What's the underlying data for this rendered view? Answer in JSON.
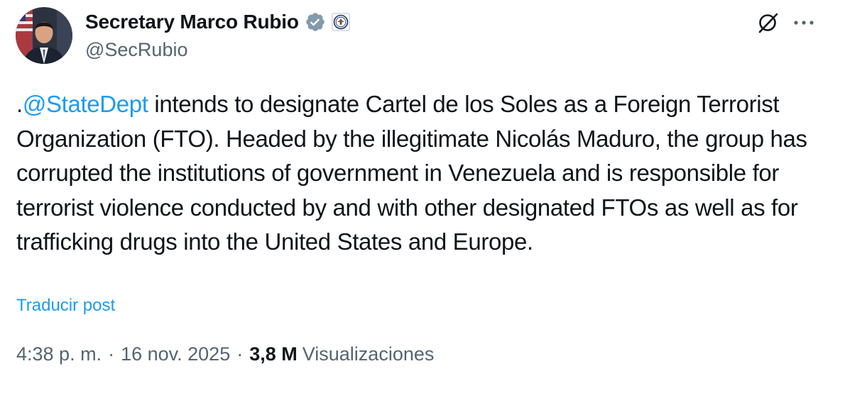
{
  "author": {
    "display_name": "Secretary Marco Rubio",
    "handle": "@SecRubio",
    "verified_badge": "gray-verified-badge-icon",
    "affiliation_badge": "us-state-department-seal-icon",
    "avatar": "profile-photo"
  },
  "header_actions": {
    "grok_icon": "grok-icon",
    "more_icon": "more-options-icon"
  },
  "tweet": {
    "prefix": ".",
    "mention": "@StateDept",
    "text": " intends to designate Cartel de los Soles as a Foreign Terrorist Organization (FTO). Headed by the illegitimate Nicolás Maduro, the group has corrupted the institutions of government in Venezuela and is responsible for terrorist violence conducted by and with other designated FTOs as well as for trafficking drugs into the United States and Europe."
  },
  "translate_label": "Traducir post",
  "meta": {
    "time": "4:38 p. m.",
    "separator": "·",
    "date": "16 nov. 2025",
    "views_count": "3,8 M",
    "views_label": "Visualizaciones"
  },
  "colors": {
    "text": "#0f1419",
    "secondary": "#536471",
    "link": "#1d9bf0",
    "background": "#ffffff"
  }
}
